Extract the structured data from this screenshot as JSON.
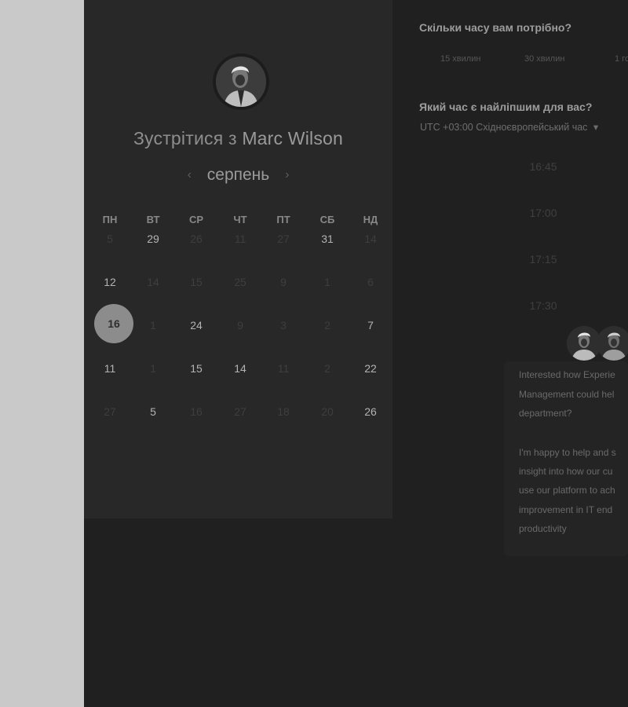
{
  "meeting": {
    "title_prefix": "Зустрітися з",
    "host_name": "Marc Wilson"
  },
  "calendar": {
    "month": "серпень",
    "weekdays": [
      "ПН",
      "ВТ",
      "СР",
      "ЧТ",
      "ПТ",
      "СБ",
      "НД"
    ],
    "weeks": [
      [
        {
          "d": "5",
          "s": "dim"
        },
        {
          "d": "29",
          "s": "avail"
        },
        {
          "d": "26",
          "s": "dim"
        },
        {
          "d": "11",
          "s": "dim"
        },
        {
          "d": "27",
          "s": "dim"
        },
        {
          "d": "31",
          "s": "avail"
        },
        {
          "d": "14",
          "s": "dim"
        }
      ],
      [
        {
          "d": "12",
          "s": "avail"
        },
        {
          "d": "14",
          "s": "dim"
        },
        {
          "d": "15",
          "s": "dim"
        },
        {
          "d": "25",
          "s": "dim"
        },
        {
          "d": "9",
          "s": "dim"
        },
        {
          "d": "1",
          "s": "dim"
        },
        {
          "d": "6",
          "s": "dim"
        }
      ],
      [
        {
          "d": "16",
          "s": "selected"
        },
        {
          "d": "1",
          "s": "dim"
        },
        {
          "d": "24",
          "s": "avail"
        },
        {
          "d": "9",
          "s": "dim"
        },
        {
          "d": "3",
          "s": "dim"
        },
        {
          "d": "2",
          "s": "dim"
        },
        {
          "d": "7",
          "s": "avail"
        }
      ],
      [
        {
          "d": "11",
          "s": "avail"
        },
        {
          "d": "1",
          "s": "dim"
        },
        {
          "d": "15",
          "s": "avail"
        },
        {
          "d": "14",
          "s": "avail"
        },
        {
          "d": "11",
          "s": "dim"
        },
        {
          "d": "2",
          "s": "dim"
        },
        {
          "d": "22",
          "s": "avail"
        }
      ],
      [
        {
          "d": "27",
          "s": "dim"
        },
        {
          "d": "5",
          "s": "avail"
        },
        {
          "d": "16",
          "s": "dim"
        },
        {
          "d": "27",
          "s": "dim"
        },
        {
          "d": "18",
          "s": "dim"
        },
        {
          "d": "20",
          "s": "dim"
        },
        {
          "d": "26",
          "s": "avail"
        }
      ]
    ]
  },
  "duration": {
    "question": "Скільки часу вам потрібно?",
    "options": [
      "15 хвилин",
      "30 хвилин",
      "1 го"
    ]
  },
  "time": {
    "question": "Який час є найліпшим для вас?",
    "timezone": "UTC +03:00 Східноєвропейський час",
    "slots": [
      "16:45",
      "17:00",
      "17:15",
      "17:30"
    ]
  },
  "chat": {
    "lines": [
      "Interested how Experie",
      "Management could hel",
      "department?",
      "",
      "I'm happy to help and s",
      "insight into how our cu",
      "use our platform to ach",
      "improvement in IT end",
      "productivity"
    ]
  },
  "colors": {
    "panel_bg": "#282828",
    "page_bg": "#202020",
    "selected_day": "#8c8c8c"
  }
}
